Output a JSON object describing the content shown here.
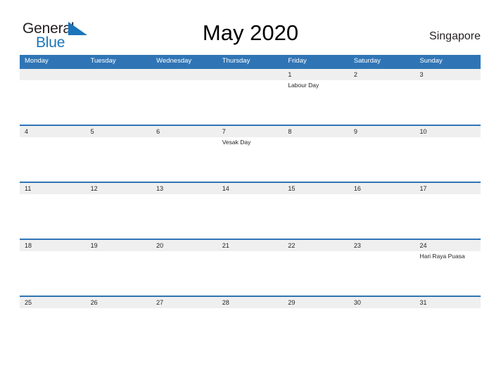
{
  "logo": {
    "word_one": "General",
    "word_two": "Blue",
    "flag_icon": "blue-triangle-flag-icon",
    "word_one_color": "#231f20",
    "word_two_color": "#1b75bb",
    "flag_color": "#1b75bb"
  },
  "header": {
    "title": "May 2020",
    "locale": "Singapore"
  },
  "theme": {
    "header_blue": "#2f75b6",
    "date_strip_gray": "#efefef",
    "body_white": "#ffffff",
    "text_dark": "#231f20"
  },
  "calendar": {
    "day_headers": [
      "Monday",
      "Tuesday",
      "Wednesday",
      "Thursday",
      "Friday",
      "Saturday",
      "Sunday"
    ],
    "weeks": [
      {
        "days": [
          {
            "date": "",
            "event": ""
          },
          {
            "date": "",
            "event": ""
          },
          {
            "date": "",
            "event": ""
          },
          {
            "date": "",
            "event": ""
          },
          {
            "date": "1",
            "event": "Labour Day"
          },
          {
            "date": "2",
            "event": ""
          },
          {
            "date": "3",
            "event": ""
          }
        ]
      },
      {
        "days": [
          {
            "date": "4",
            "event": ""
          },
          {
            "date": "5",
            "event": ""
          },
          {
            "date": "6",
            "event": ""
          },
          {
            "date": "7",
            "event": "Vesak Day"
          },
          {
            "date": "8",
            "event": ""
          },
          {
            "date": "9",
            "event": ""
          },
          {
            "date": "10",
            "event": ""
          }
        ]
      },
      {
        "days": [
          {
            "date": "11",
            "event": ""
          },
          {
            "date": "12",
            "event": ""
          },
          {
            "date": "13",
            "event": ""
          },
          {
            "date": "14",
            "event": ""
          },
          {
            "date": "15",
            "event": ""
          },
          {
            "date": "16",
            "event": ""
          },
          {
            "date": "17",
            "event": ""
          }
        ]
      },
      {
        "days": [
          {
            "date": "18",
            "event": ""
          },
          {
            "date": "19",
            "event": ""
          },
          {
            "date": "20",
            "event": ""
          },
          {
            "date": "21",
            "event": ""
          },
          {
            "date": "22",
            "event": ""
          },
          {
            "date": "23",
            "event": ""
          },
          {
            "date": "24",
            "event": "Hari Raya Puasa"
          }
        ]
      },
      {
        "days": [
          {
            "date": "25",
            "event": ""
          },
          {
            "date": "26",
            "event": ""
          },
          {
            "date": "27",
            "event": ""
          },
          {
            "date": "28",
            "event": ""
          },
          {
            "date": "29",
            "event": ""
          },
          {
            "date": "30",
            "event": ""
          },
          {
            "date": "31",
            "event": ""
          }
        ]
      }
    ]
  }
}
